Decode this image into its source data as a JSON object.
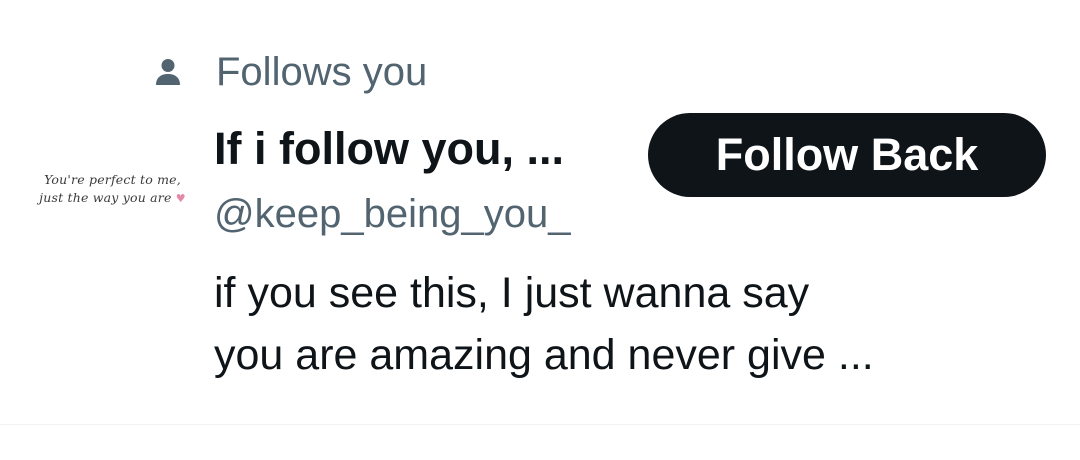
{
  "context": {
    "icon": "person-icon",
    "label": "Follows you"
  },
  "user": {
    "avatar_text_line1": "You're perfect to me,",
    "avatar_text_line2": "just the way you are",
    "display_name": "If i follow you, ...",
    "handle": "@keep_being_you_",
    "bio_line1": "if you see this, I just wanna say",
    "bio_line2": "you are amazing and never give ..."
  },
  "actions": {
    "follow_back_label": "Follow Back"
  },
  "colors": {
    "text_primary": "#0f1419",
    "text_secondary": "#536471",
    "button_bg": "#0f1419",
    "button_text": "#ffffff",
    "divider": "#eff3f4",
    "heart": "#e58aa6"
  }
}
